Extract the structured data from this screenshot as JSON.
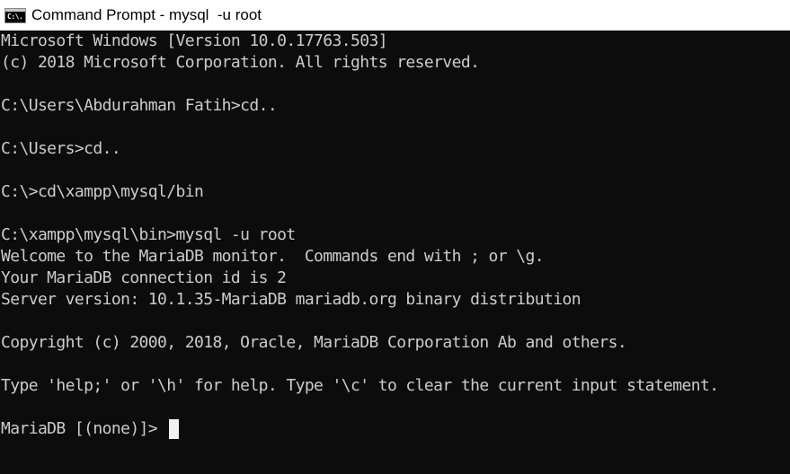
{
  "window": {
    "title": "Command Prompt - mysql  -u root",
    "icon": "cmd-icon",
    "icon_glyph": "C:\\."
  },
  "console": {
    "lines": [
      "Microsoft Windows [Version 10.0.17763.503]",
      "(c) 2018 Microsoft Corporation. All rights reserved.",
      "",
      "C:\\Users\\Abdurahman Fatih>cd..",
      "",
      "C:\\Users>cd..",
      "",
      "C:\\>cd\\xampp\\mysql/bin",
      "",
      "C:\\xampp\\mysql\\bin>mysql -u root",
      "Welcome to the MariaDB monitor.  Commands end with ; or \\g.",
      "Your MariaDB connection id is 2",
      "Server version: 10.1.35-MariaDB mariadb.org binary distribution",
      "",
      "Copyright (c) 2000, 2018, Oracle, MariaDB Corporation Ab and others.",
      "",
      "Type 'help;' or '\\h' for help. Type '\\c' to clear the current input statement.",
      ""
    ],
    "prompt": "MariaDB [(none)]>"
  },
  "colors": {
    "background": "#0c0c0c",
    "foreground": "#cccccc",
    "titlebar": "#ffffff",
    "cursor": "#f2f2f2"
  }
}
